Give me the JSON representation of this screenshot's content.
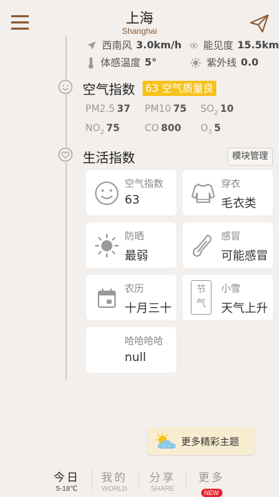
{
  "header": {
    "city": "上海",
    "city_en": "Shanghai"
  },
  "weather": {
    "wind_label": "西南风",
    "wind_value": "3.0km/h",
    "visibility_label": "能见度",
    "visibility_value": "15.5km",
    "feels_label": "体感温度",
    "feels_value": "5°",
    "uv_label": "紫外线",
    "uv_value": "0.0"
  },
  "air": {
    "title": "空气指数",
    "badge": "63 空气质量良",
    "pollutants": {
      "pm25_label": "PM2.5",
      "pm25_value": "37",
      "pm10_label": "PM10",
      "pm10_value": "75",
      "so2_main": "SO",
      "so2_sub": "2",
      "so2_value": "10",
      "no2_main": "NO",
      "no2_sub": "2",
      "no2_value": "75",
      "co_label": "CO",
      "co_value": "800",
      "o3_main": "O",
      "o3_sub": "3",
      "o3_value": "5"
    }
  },
  "life": {
    "title": "生活指数",
    "module_btn": "模块管理",
    "cards": [
      {
        "label": "空气指数",
        "value": "63",
        "icon": "smiley-icon"
      },
      {
        "label": "穿衣",
        "value": "毛衣类",
        "icon": "sweater-icon"
      },
      {
        "label": "防晒",
        "value": "最弱",
        "icon": "sun-icon"
      },
      {
        "label": "感冒",
        "value": "可能感冒",
        "icon": "thermometer-icon"
      },
      {
        "label": "农历",
        "value": "十月三十",
        "icon": "calendar-icon"
      },
      {
        "label": "小雪",
        "value": "天气上升",
        "icon": "solar-term-icon",
        "icon_text_1": "节",
        "icon_text_2": "气"
      },
      {
        "label": "哈哈哈哈",
        "value": "null",
        "icon": "blank-icon"
      }
    ]
  },
  "themes_btn": "更多精彩主题",
  "nav": [
    {
      "label": "今日",
      "sub": "5-18℃",
      "active": true
    },
    {
      "label": "我的",
      "sub": "WORLD"
    },
    {
      "label": "分享",
      "sub": "SHARE"
    },
    {
      "label": "更多",
      "badge": "NEW"
    }
  ],
  "colors": {
    "accent": "#8a5a36",
    "badge": "#f6c21b",
    "new_badge": "#e3262e",
    "background": "#f2efec"
  }
}
